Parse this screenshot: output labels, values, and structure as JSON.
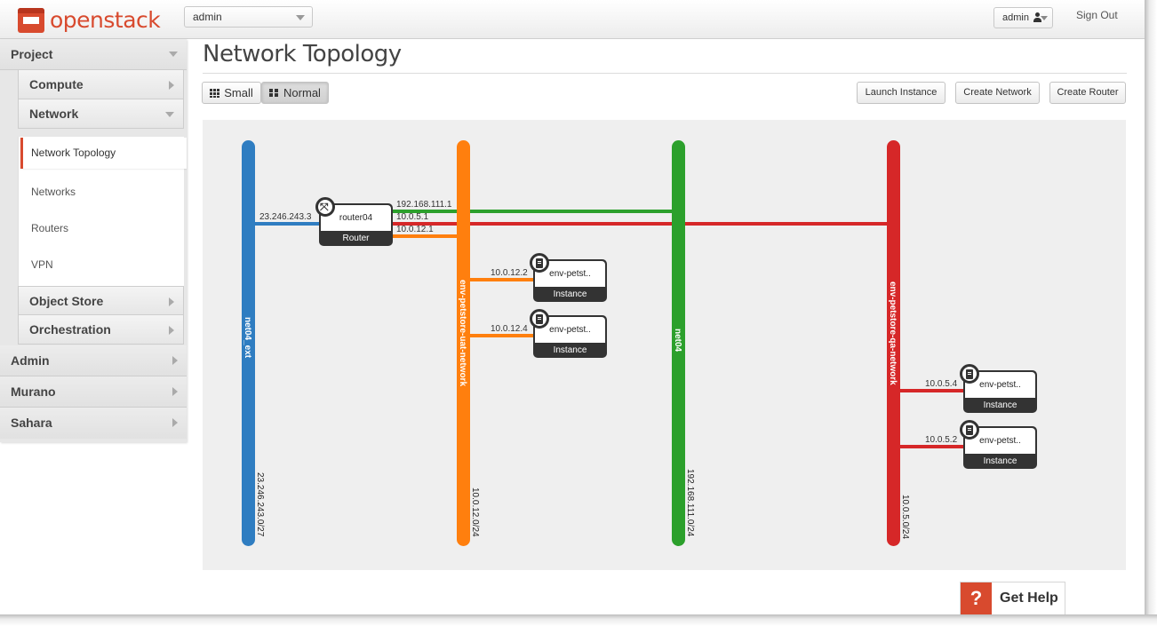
{
  "brand": {
    "name": "openstack",
    "color": "#d84a2e"
  },
  "header": {
    "project_selector": "admin",
    "user_menu": "admin",
    "sign_out": "Sign Out"
  },
  "sidebar": {
    "dashboards": [
      {
        "label": "Project",
        "expanded": true
      },
      {
        "label": "Admin",
        "expanded": false
      },
      {
        "label": "Murano",
        "expanded": false
      },
      {
        "label": "Sahara",
        "expanded": false
      }
    ],
    "panel_groups": [
      {
        "label": "Compute",
        "expanded": false
      },
      {
        "label": "Network",
        "expanded": true
      },
      {
        "label": "Object Store",
        "expanded": false
      },
      {
        "label": "Orchestration",
        "expanded": false
      }
    ],
    "network_items": [
      "Network Topology",
      "Networks",
      "Routers",
      "VPN"
    ],
    "active_item": "Network Topology"
  },
  "page": {
    "title": "Network Topology",
    "view_toggle": {
      "small": "Small",
      "normal": "Normal",
      "selected": "Normal"
    },
    "actions": {
      "launch_instance": "Launch Instance",
      "create_network": "Create Network",
      "create_router": "Create Router"
    }
  },
  "topology": {
    "networks": [
      {
        "name": "net04_ext",
        "cidr": "23.246.243.0/27",
        "color": "#2f7dc1"
      },
      {
        "name": "env-petstore-uat-network",
        "cidr": "10.0.12.0/24",
        "color": "#ff7f0e"
      },
      {
        "name": "net04",
        "cidr": "192.168.111.0/24",
        "color": "#2ca02c"
      },
      {
        "name": "env-petstore-qa-network",
        "cidr": "10.0.5.0/24",
        "color": "#d62728"
      }
    ],
    "router": {
      "name": "router04",
      "type": "Router",
      "ports": {
        "external": "23.246.243.3",
        "net04": "192.168.111.1",
        "qa": "10.0.5.1",
        "uat": "10.0.12.1"
      }
    },
    "instances": [
      {
        "name": "env-petst..",
        "type": "Instance",
        "ip": "10.0.12.2",
        "network": "env-petstore-uat-network"
      },
      {
        "name": "env-petst..",
        "type": "Instance",
        "ip": "10.0.12.4",
        "network": "env-petstore-uat-network"
      },
      {
        "name": "env-petst..",
        "type": "Instance",
        "ip": "10.0.5.4",
        "network": "env-petstore-qa-network"
      },
      {
        "name": "env-petst..",
        "type": "Instance",
        "ip": "10.0.5.2",
        "network": "env-petstore-qa-network"
      }
    ]
  },
  "help": {
    "icon": "?",
    "label": "Get Help"
  }
}
